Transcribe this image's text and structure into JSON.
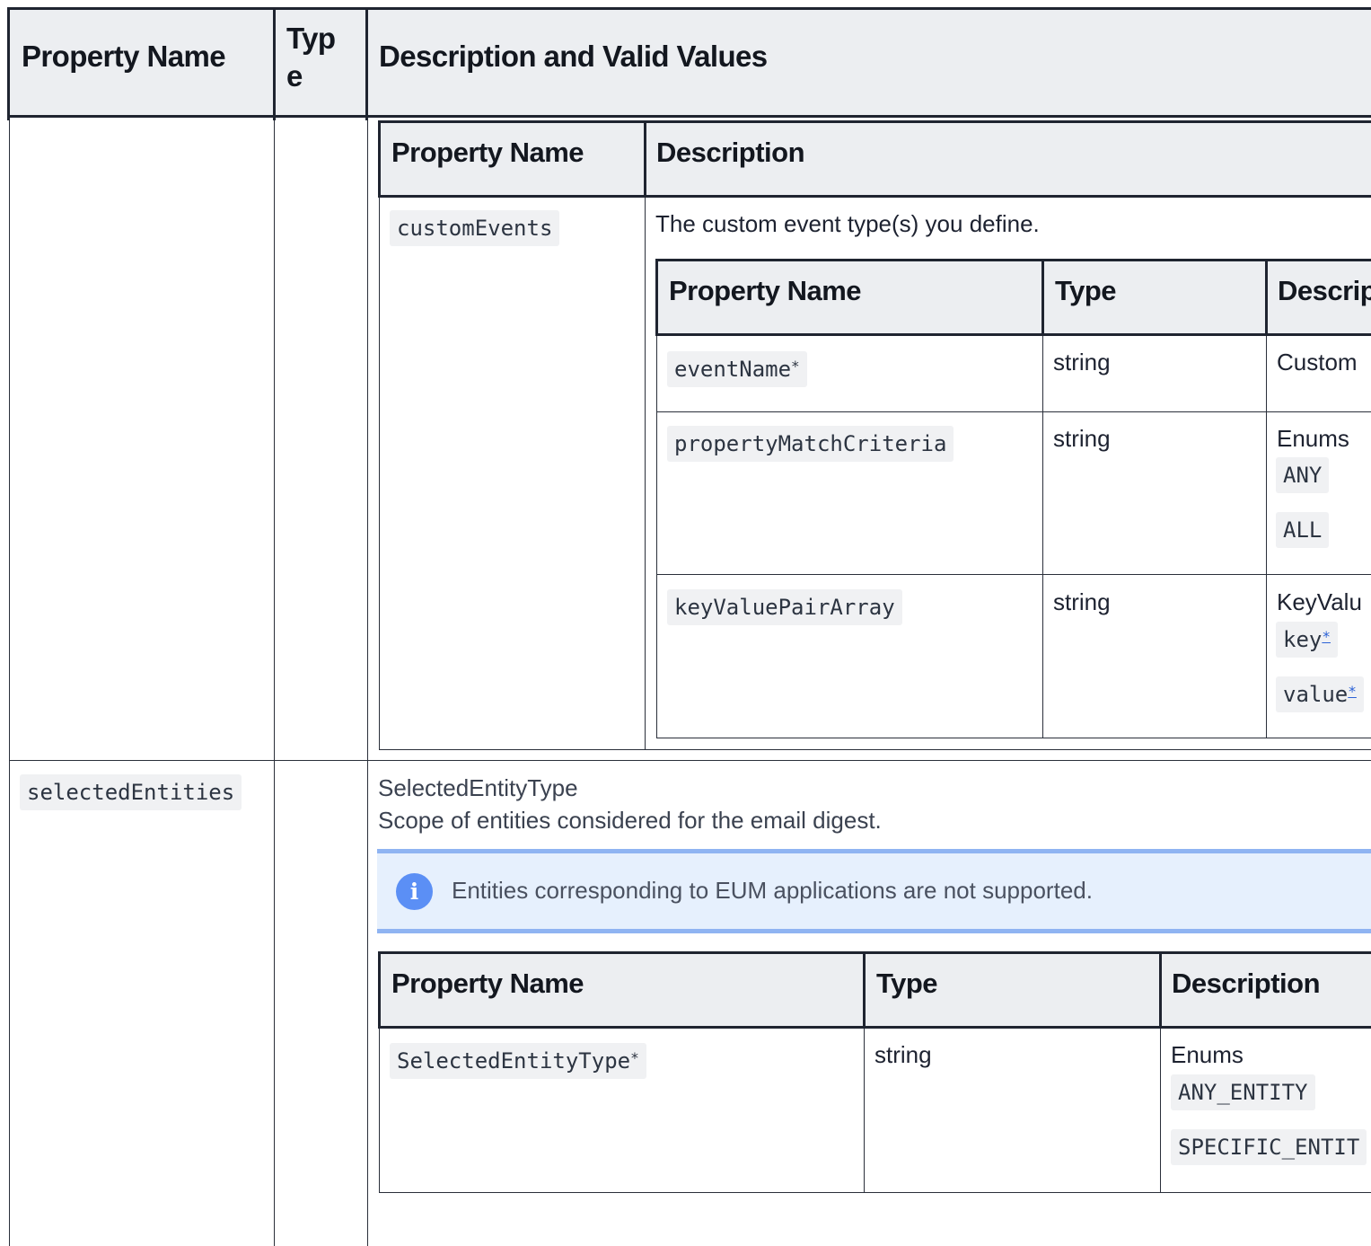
{
  "outer": {
    "headers": [
      "Property Name",
      "Typ",
      "e",
      "Description and Valid Values"
    ]
  },
  "nested1": {
    "headers": [
      "Property Name",
      "Description"
    ],
    "row": {
      "property": "customEvents",
      "description": "The custom event type(s) you define."
    }
  },
  "nested2": {
    "headers": [
      "Property Name",
      "Type",
      "Descrip"
    ],
    "rows": [
      {
        "property": "eventName",
        "required_mark": "*",
        "type": "string",
        "description": "Custom"
      },
      {
        "property": "propertyMatchCriteria",
        "type": "string",
        "description": "Enums",
        "values": [
          "ANY",
          "ALL"
        ]
      },
      {
        "property": "keyValuePairArray",
        "type": "string",
        "description": "KeyValu",
        "values": [
          "key",
          "value"
        ],
        "required_mark": "*"
      }
    ]
  },
  "selected": {
    "property": "selectedEntities",
    "type_name": "SelectedEntityType",
    "description": "Scope of entities considered for the email digest.",
    "note": "Entities corresponding to EUM applications are not supported.",
    "info_icon_glyph": "i",
    "info_color": "#5b8ff5",
    "table": {
      "headers": [
        "Property Name",
        "Type",
        "Description"
      ],
      "row": {
        "property": "SelectedEntityType",
        "required_mark": "*",
        "type": "string",
        "description": "Enums",
        "values": [
          "ANY_ENTITY",
          "SPECIFIC_ENTIT"
        ]
      }
    }
  }
}
